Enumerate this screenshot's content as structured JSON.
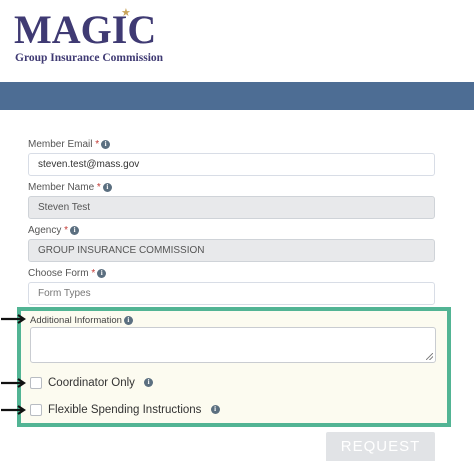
{
  "logo": {
    "name": "MAGIC",
    "subtitle": "Group Insurance Commission",
    "star": "★"
  },
  "form": {
    "member_email": {
      "label": "Member Email",
      "required": "*",
      "value": "steven.test@mass.gov"
    },
    "member_name": {
      "label": "Member Name",
      "required": "*",
      "value": "Steven Test"
    },
    "agency": {
      "label": "Agency",
      "required": "*",
      "value": "GROUP INSURANCE COMMISSION"
    },
    "choose_form": {
      "label": "Choose Form",
      "required": "*",
      "placeholder": "Form Types"
    },
    "additional_info": {
      "label": "Additional Information",
      "value": ""
    },
    "coordinator_only": {
      "label": "Coordinator Only"
    },
    "flexible_spending": {
      "label": "Flexible Spending Instructions"
    },
    "info_glyph": "i",
    "request_button": "REQUEST"
  },
  "colors": {
    "banner": "#4d6d94",
    "highlight_border": "#52b494",
    "logo_text": "#3f3a73"
  }
}
